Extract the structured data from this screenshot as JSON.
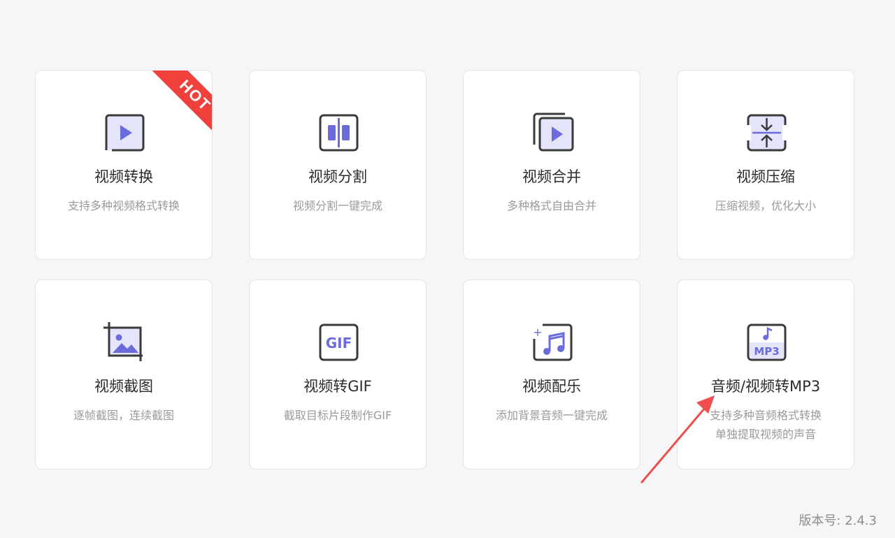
{
  "cards": [
    {
      "title": "视频转换",
      "desc": [
        "支持多种视频格式转换"
      ],
      "badge": "HOT",
      "icon": "video-convert-icon"
    },
    {
      "title": "视频分割",
      "desc": [
        "视频分割一键完成"
      ],
      "icon": "video-split-icon"
    },
    {
      "title": "视频合并",
      "desc": [
        "多种格式自由合并"
      ],
      "icon": "video-merge-icon"
    },
    {
      "title": "视频压缩",
      "desc": [
        "压缩视频，优化大小"
      ],
      "icon": "video-compress-icon"
    },
    {
      "title": "视频截图",
      "desc": [
        "逐帧截图，连续截图"
      ],
      "icon": "video-screenshot-icon"
    },
    {
      "title": "视频转GIF",
      "desc": [
        "截取目标片段制作GIF"
      ],
      "icon": "gif-icon",
      "icon_text": "GIF"
    },
    {
      "title": "视频配乐",
      "desc": [
        "添加背景音频一键完成"
      ],
      "icon": "music-add-icon",
      "icon_plus": "+"
    },
    {
      "title": "音频/视频转MP3",
      "desc": [
        "支持多种音频格式转换",
        "单独提取视频的声音"
      ],
      "icon": "mp3-icon",
      "icon_text": "MP3"
    }
  ],
  "version": "版本号: 2.4.3",
  "colors": {
    "accent": "#6b6bdc",
    "accent_light": "#e4e4fa",
    "outline": "#3a3a3a",
    "hot": "#f0403b",
    "arrow": "#ee4e4e"
  }
}
